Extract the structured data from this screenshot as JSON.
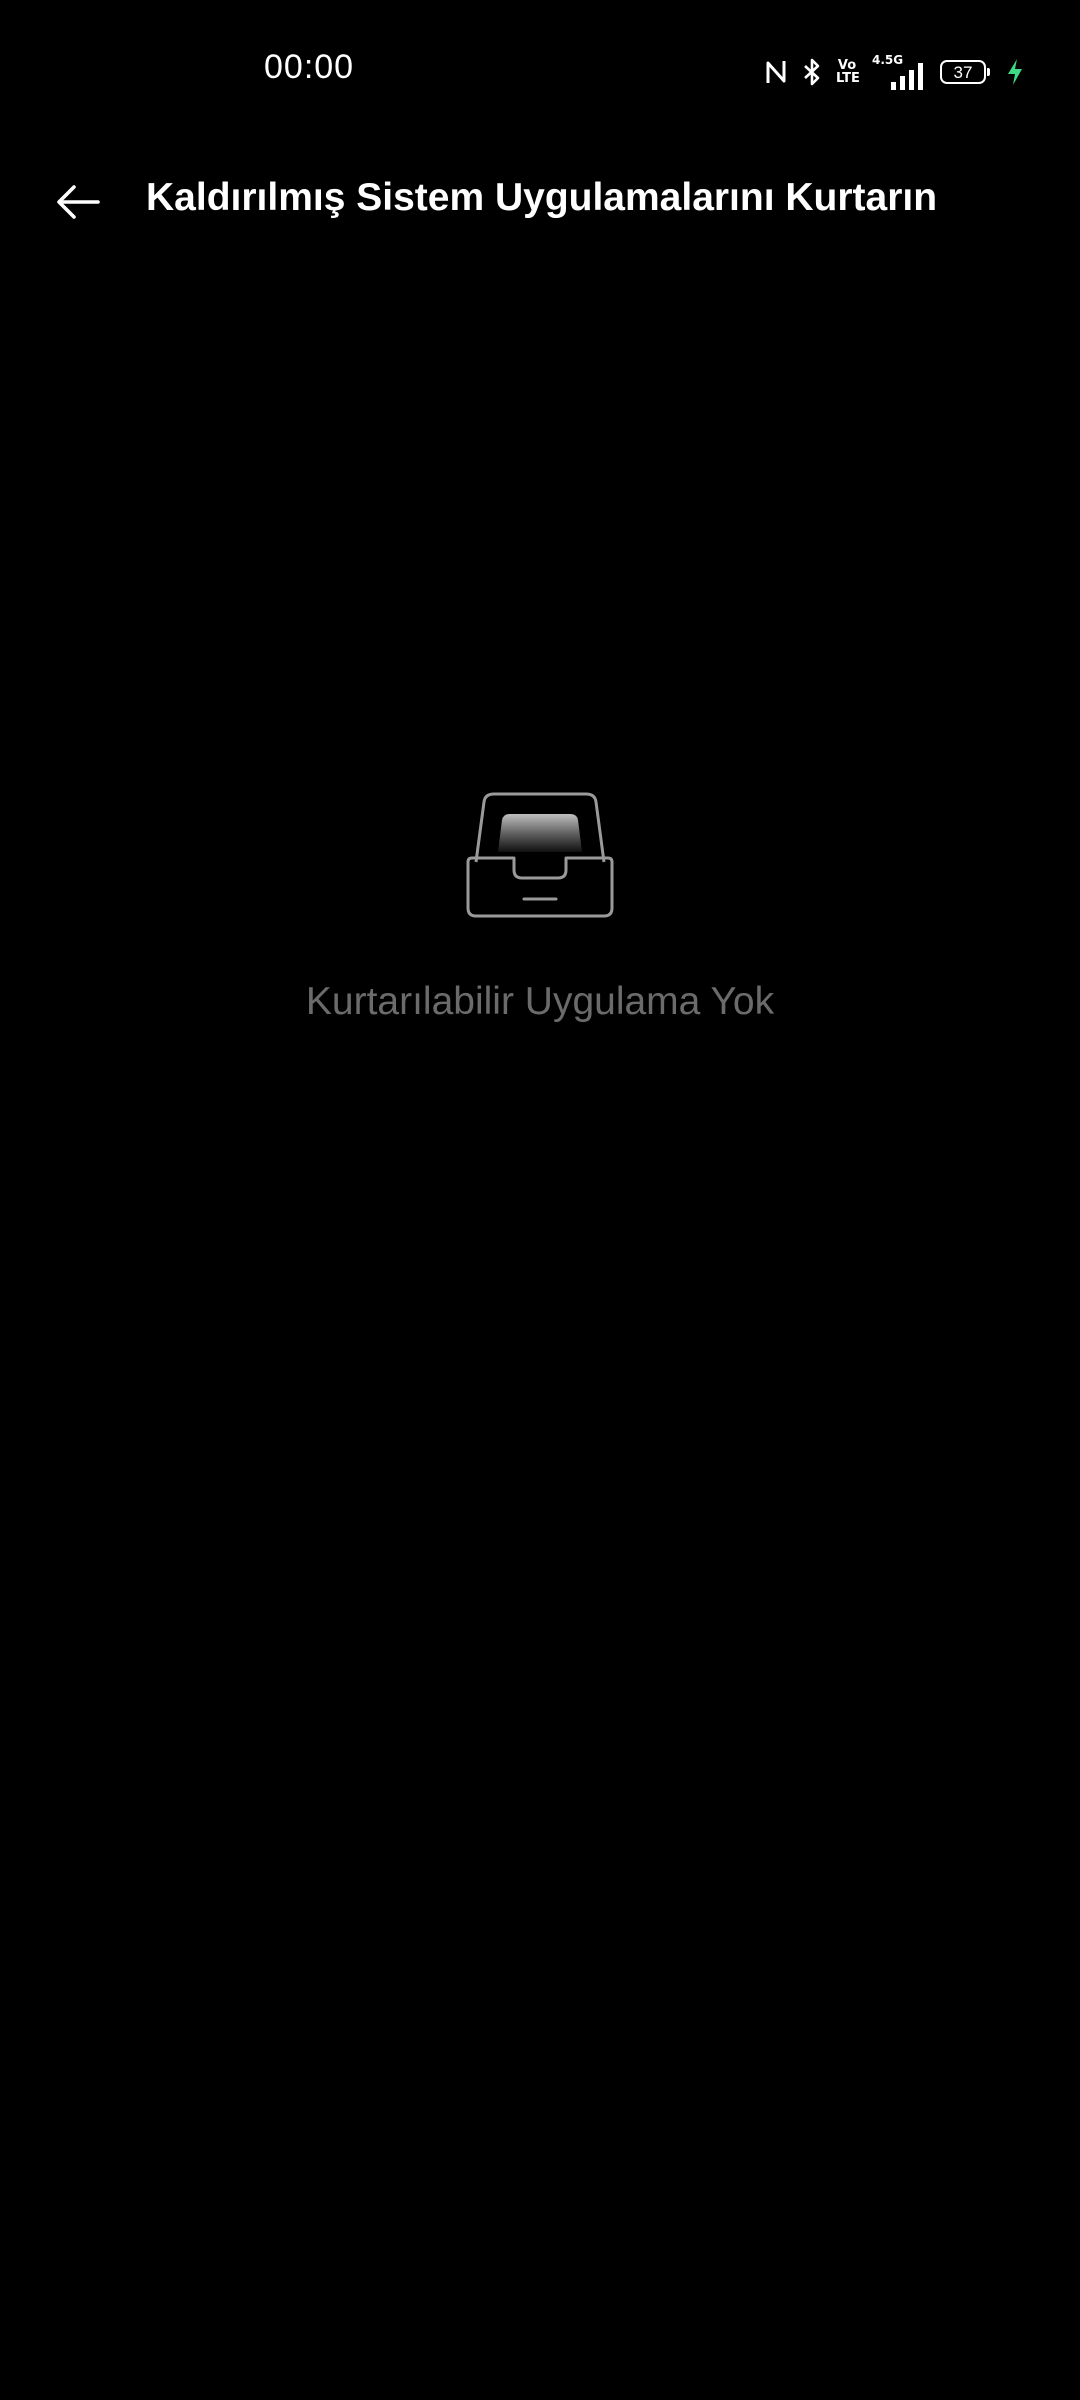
{
  "status_bar": {
    "time": "00:00",
    "volte_top": "Vo",
    "volte_bottom": "LTE",
    "network_type": "4.5G",
    "battery_level": "37",
    "icons": [
      "nfc-icon",
      "bluetooth-icon",
      "volte-icon",
      "signal-icon",
      "battery-icon",
      "charging-icon"
    ],
    "charging_color": "#3ddc84"
  },
  "app_bar": {
    "back_icon": "arrow-left-icon",
    "title": "Kaldırılmış Sistem Uygulamalarını Kurtarın"
  },
  "empty_state": {
    "icon": "empty-tray-icon",
    "message": "Kurtarılabilir Uygulama Yok",
    "text_color": "#6b6b6b"
  }
}
